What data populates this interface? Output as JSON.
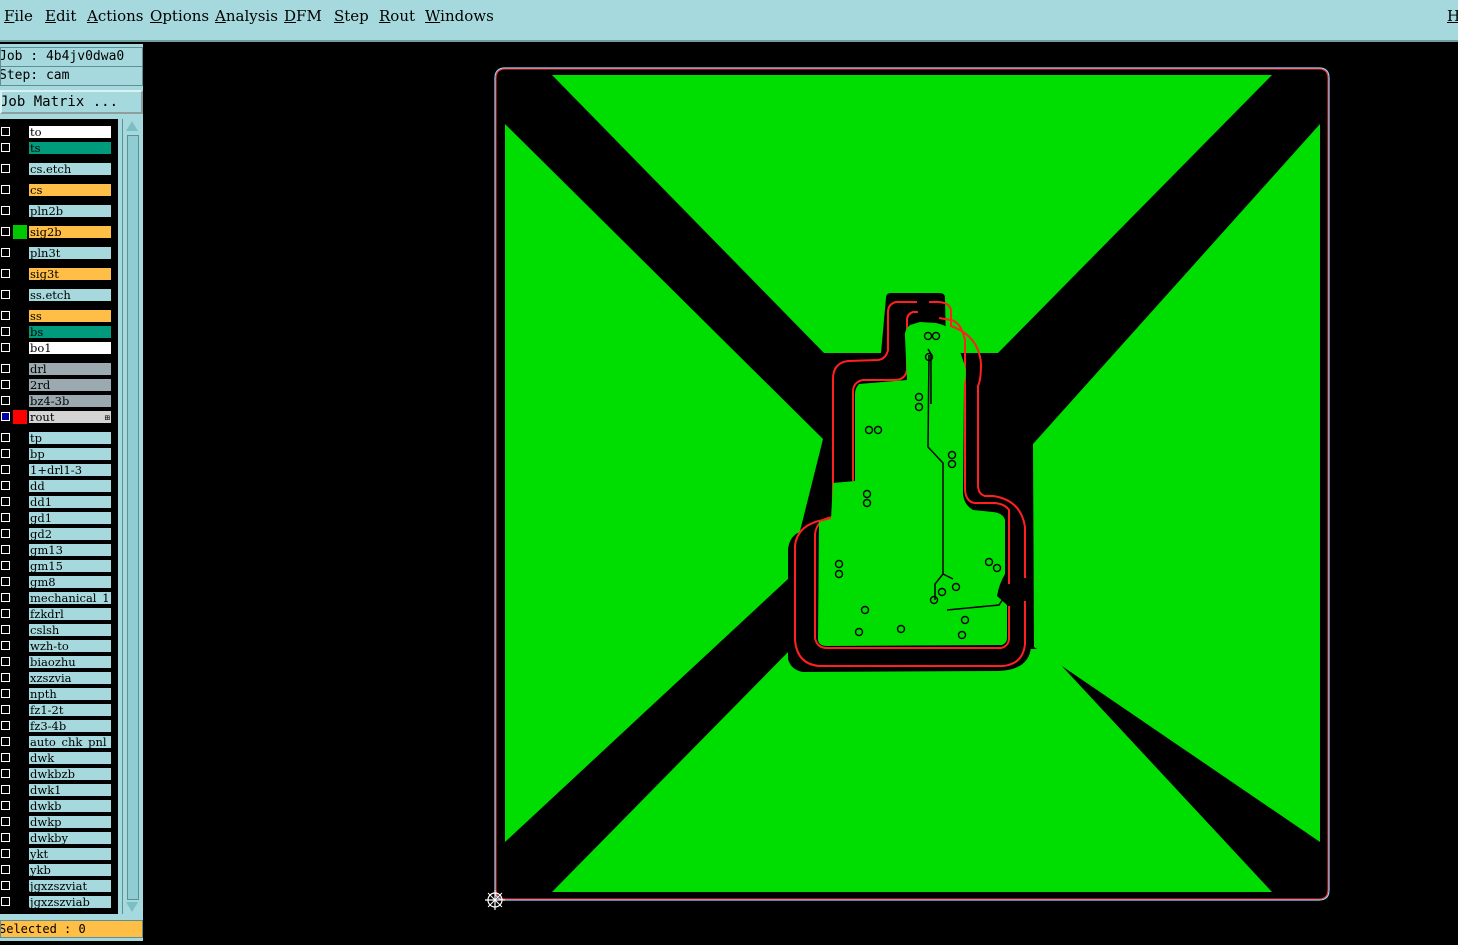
{
  "menubar": {
    "items": [
      "File",
      "Edit",
      "Actions",
      "Options",
      "Analysis",
      "DFM",
      "Step",
      "Rout",
      "Windows"
    ],
    "help_label": "H"
  },
  "panel": {
    "job_label": "Job : 4b4jv0dwa0",
    "step_label": "Step: cam",
    "job_matrix_button": "Job Matrix ...",
    "status_text": "Selected : 0"
  },
  "layers": [
    {
      "name": "to",
      "color": "white"
    },
    {
      "name": "ts",
      "color": "teal"
    },
    {
      "name": "cs.etch",
      "color": "cyan"
    },
    {
      "name": "cs",
      "color": "orange"
    },
    {
      "name": "pln2b",
      "color": "cyan"
    },
    {
      "name": "sig2b",
      "color": "orange",
      "swatch": "#00c800"
    },
    {
      "name": "pln3t",
      "color": "cyan"
    },
    {
      "name": "sig3t",
      "color": "orange"
    },
    {
      "name": "ss.etch",
      "color": "cyan"
    },
    {
      "name": "ss",
      "color": "orange"
    },
    {
      "name": "bs",
      "color": "teal"
    },
    {
      "name": "bo1",
      "color": "white"
    },
    {
      "name": "drl",
      "color": "gray"
    },
    {
      "name": "2rd",
      "color": "gray"
    },
    {
      "name": "bz4-3b",
      "color": "gray"
    },
    {
      "name": "rout",
      "color": "rout",
      "swatch": "#ff0000",
      "active": true
    },
    {
      "name": "tp",
      "color": "cyan"
    },
    {
      "name": "bp",
      "color": "cyan"
    },
    {
      "name": "1+drl1-3",
      "color": "cyan"
    },
    {
      "name": "dd",
      "color": "cyan"
    },
    {
      "name": "dd1",
      "color": "cyan"
    },
    {
      "name": "gd1",
      "color": "cyan"
    },
    {
      "name": "gd2",
      "color": "cyan"
    },
    {
      "name": "gm13",
      "color": "cyan"
    },
    {
      "name": "gm15",
      "color": "cyan"
    },
    {
      "name": "gm8",
      "color": "cyan"
    },
    {
      "name": "mechanical_1",
      "color": "cyan"
    },
    {
      "name": "fzkdrl",
      "color": "cyan"
    },
    {
      "name": "cslsh",
      "color": "cyan"
    },
    {
      "name": "wzh-to",
      "color": "cyan"
    },
    {
      "name": "biaozhu",
      "color": "cyan"
    },
    {
      "name": "xzszvia",
      "color": "cyan"
    },
    {
      "name": "npth",
      "color": "cyan"
    },
    {
      "name": "fz1-2t",
      "color": "cyan"
    },
    {
      "name": "fz3-4b",
      "color": "cyan"
    },
    {
      "name": "auto_chk_pnl",
      "color": "cyan"
    },
    {
      "name": "dwk",
      "color": "cyan"
    },
    {
      "name": "dwkbzb",
      "color": "cyan"
    },
    {
      "name": "dwk1",
      "color": "cyan"
    },
    {
      "name": "dwkb",
      "color": "cyan"
    },
    {
      "name": "dwkp",
      "color": "cyan"
    },
    {
      "name": "dwkby",
      "color": "cyan"
    },
    {
      "name": "ykt",
      "color": "cyan"
    },
    {
      "name": "ykb",
      "color": "cyan"
    },
    {
      "name": "jgxzszviat",
      "color": "cyan"
    },
    {
      "name": "jgxzszviab",
      "color": "cyan"
    }
  ],
  "colors": {
    "menubar_bg": "#a6d9dd",
    "copper": "#00dd00",
    "rout": "#ff0000",
    "outline": "#8fd8ff"
  }
}
